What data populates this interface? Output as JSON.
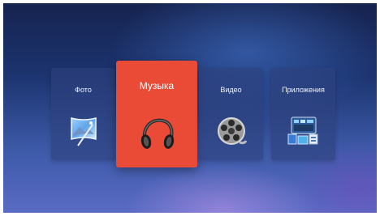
{
  "menu": {
    "items": [
      {
        "label": "Фото",
        "icon": "photo-icon"
      },
      {
        "label": "Музыка",
        "icon": "headphones-icon",
        "selected": true
      },
      {
        "label": "Видео",
        "icon": "film-reel-icon"
      },
      {
        "label": "Приложения",
        "icon": "apps-icon"
      }
    ]
  },
  "colors": {
    "active_tile": "#ea4b37",
    "tile": "#2d417d",
    "background": "#1c3470"
  }
}
